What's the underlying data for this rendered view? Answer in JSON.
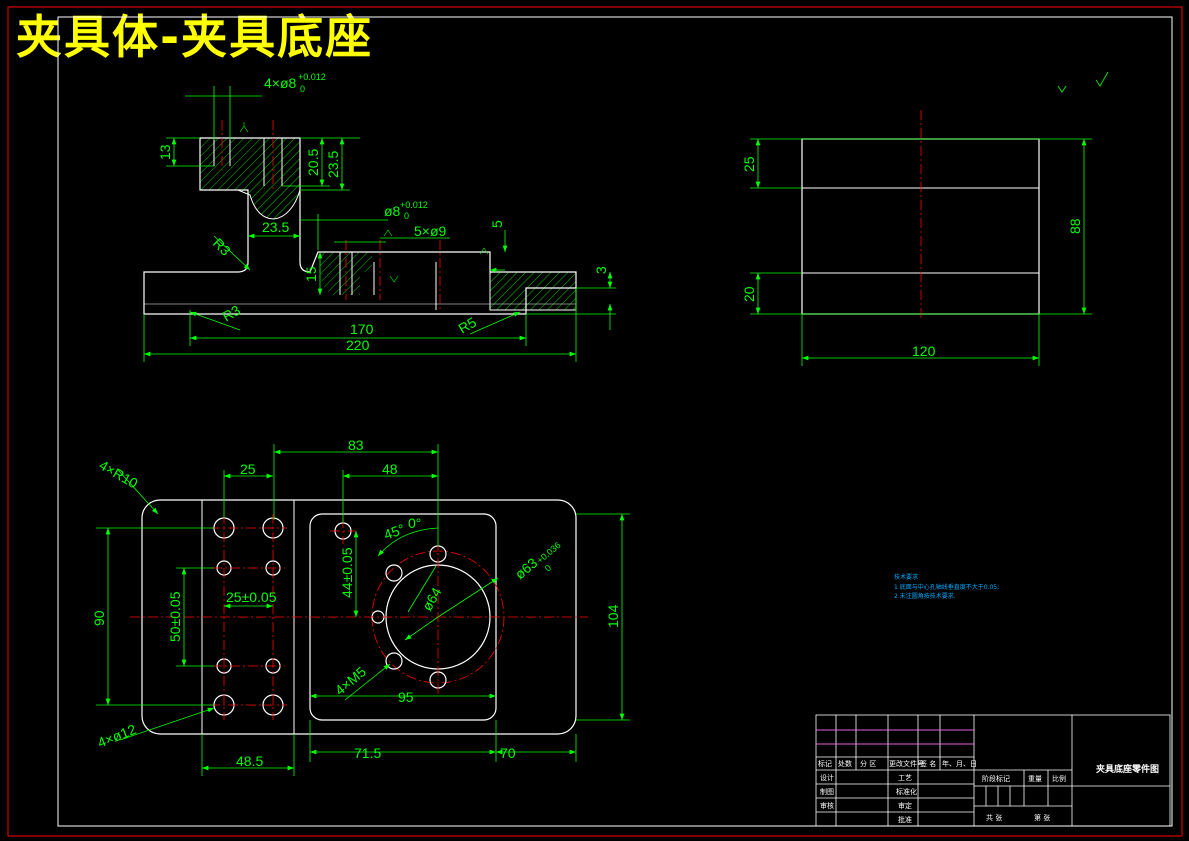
{
  "title": "夹具体-夹具底座",
  "colors": {
    "background": "#000000",
    "border": "#ff0000",
    "outline": "#ffffff",
    "dimension": "#00ff00",
    "centerline": "#ff0000",
    "hatch": "#00ff00",
    "title": "#ffff00",
    "notes": "#00aaff"
  },
  "front_view": {
    "labels": {
      "holes_top": "4×ø8",
      "tol_top_upper": "+0.012",
      "tol_top_lower": "0",
      "d13": "13",
      "d20_5": "20.5",
      "d23_5v": "23.5",
      "r3_upper": "R3",
      "d23_5h": "23.5",
      "hole8": "ø8",
      "tol_hole8_upper": "+0.012",
      "tol_hole8_lower": "0",
      "holes5": "5×ø9",
      "d5": "5",
      "d15": "15",
      "d3": "3",
      "r3_lower": "R3",
      "r5": "R5",
      "d170": "170",
      "d220": "220"
    }
  },
  "side_view": {
    "labels": {
      "d25": "25",
      "d20": "20",
      "d88": "88",
      "d120": "120"
    }
  },
  "top_view": {
    "labels": {
      "r10": "4×R10",
      "d83": "83",
      "d25": "25",
      "d48": "48",
      "d90": "90",
      "d50": "50±0.05",
      "d25b": "25±0.05",
      "d44": "44±0.05",
      "ang45": "45°",
      "ang0": "0°",
      "dia63": "ø63",
      "tol63": "+0.036",
      "tol63b": "0",
      "dia64": "ø64",
      "holes_m5": "4×M5",
      "d104": "104",
      "d95": "95",
      "holes12": "4×ø12",
      "d48_5": "48.5",
      "d71_5": "71.5",
      "d70": "70"
    }
  },
  "notes": {
    "heading": "技术要求",
    "line1": "1 底面与中心孔轴线垂直度不大于0.05;",
    "line2": "2 未注圆角按技术要求."
  },
  "title_block": {
    "name": "夹具底座零件图",
    "cells": {
      "mark": "标记",
      "count": "处数",
      "zone": "分 区",
      "doc": "更改文件号",
      "sign": "签 名",
      "date": "年、月、日",
      "design": "设计",
      "standard": "标准化",
      "draw": "制图",
      "craft": "工艺",
      "check": "审核",
      "review": "审定",
      "approve": "批准",
      "stage": "阶段标记",
      "weight": "重量",
      "ratio": "比例",
      "sheets": "共 张",
      "sheet": "第 张"
    }
  }
}
